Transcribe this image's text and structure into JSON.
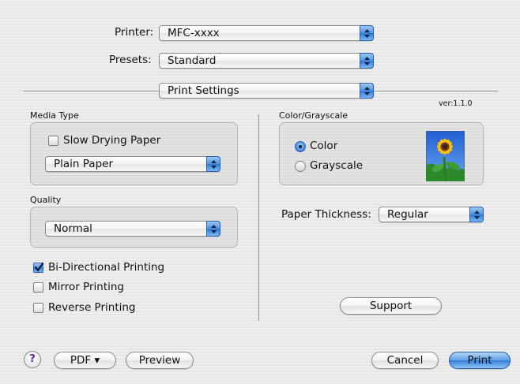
{
  "top": {
    "printer_label": "Printer:",
    "printer_value": "MFC-xxxx",
    "presets_label": "Presets:",
    "presets_value": "Standard",
    "panel_value": "Print Settings"
  },
  "left": {
    "media_type_title": "Media Type",
    "slow_drying_label": "Slow Drying Paper",
    "slow_drying_checked": false,
    "media_value": "Plain Paper",
    "quality_title": "Quality",
    "quality_value": "Normal",
    "bidirectional_label": "Bi-Directional Printing",
    "bidirectional_checked": true,
    "mirror_label": "Mirror Printing",
    "mirror_checked": false,
    "reverse_label": "Reverse Printing",
    "reverse_checked": false
  },
  "right": {
    "version": "ver:1.1.0",
    "color_title": "Color/Grayscale",
    "color_label": "Color",
    "grayscale_label": "Grayscale",
    "selected_mode": "Color",
    "preview_icon": "sunflower-image",
    "paper_thickness_label": "Paper Thickness:",
    "paper_thickness_value": "Regular",
    "support_button": "Support"
  },
  "bottom": {
    "help_icon": "question-mark-icon",
    "help_glyph": "?",
    "pdf_button": "PDF ▾",
    "preview_button": "Preview",
    "cancel_button": "Cancel",
    "print_button": "Print"
  },
  "colors": {
    "accent": "#3380db",
    "background": "#ececec"
  }
}
